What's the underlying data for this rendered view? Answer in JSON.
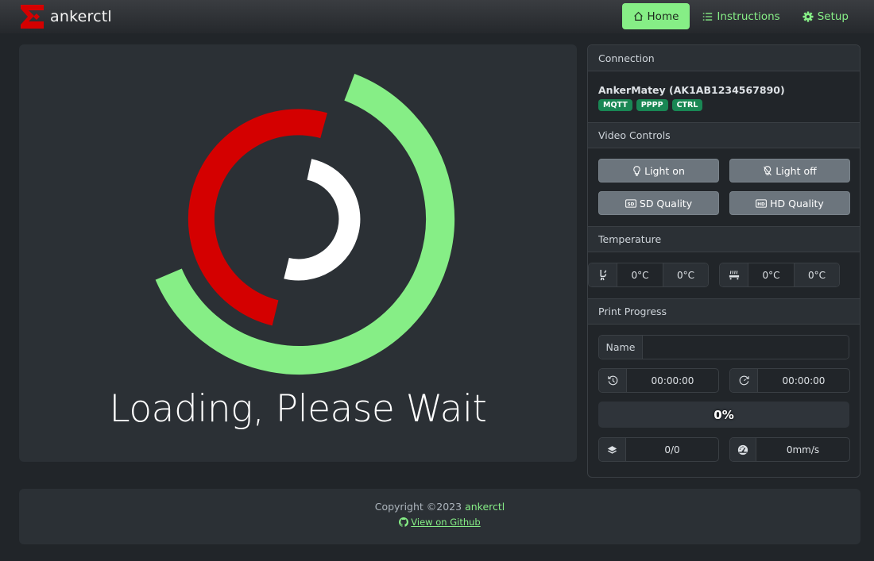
{
  "app": {
    "title": "ankerctl",
    "brand_color": "#d40000",
    "accent_color": "#86ee86"
  },
  "nav": {
    "items": [
      {
        "label": "Home",
        "icon": "house-icon",
        "active": true
      },
      {
        "label": "Instructions",
        "icon": "list-icon",
        "active": false
      },
      {
        "label": "Setup",
        "icon": "gear-icon",
        "active": false
      }
    ]
  },
  "video": {
    "loading_text": "Loading, Please Wait",
    "spinner_colors": {
      "outer": "#86ee86",
      "middle": "#d40000",
      "inner": "#ffffff"
    }
  },
  "connection": {
    "title": "Connection",
    "printer": "AnkerMatey (AK1AB1234567890)",
    "badges": [
      "MQTT",
      "PPPP",
      "CTRL"
    ]
  },
  "video_controls": {
    "title": "Video Controls",
    "buttons": [
      {
        "label": "Light on",
        "icon": "lightbulb-icon"
      },
      {
        "label": "Light off",
        "icon": "lightbulb-off-icon"
      },
      {
        "label": "SD Quality",
        "icon": "sd-icon"
      },
      {
        "label": "HD Quality",
        "icon": "hd-icon"
      }
    ]
  },
  "temperature": {
    "title": "Temperature",
    "nozzle": {
      "icon": "nozzle-icon",
      "current": "0°C",
      "target": "0°C"
    },
    "bed": {
      "icon": "heated-bed-icon",
      "current": "0°C",
      "target": "0°C"
    }
  },
  "print_progress": {
    "title": "Print Progress",
    "name_label": "Name",
    "name_value": "",
    "elapsed": "00:00:00",
    "remaining": "00:00:00",
    "progress_percent": 0,
    "progress_label": "0%",
    "layers": "0/0",
    "speed": "0mm/s"
  },
  "footer": {
    "copyright": "Copyright ©2023",
    "brand_link": "ankerctl",
    "github_link": "View on Github"
  }
}
